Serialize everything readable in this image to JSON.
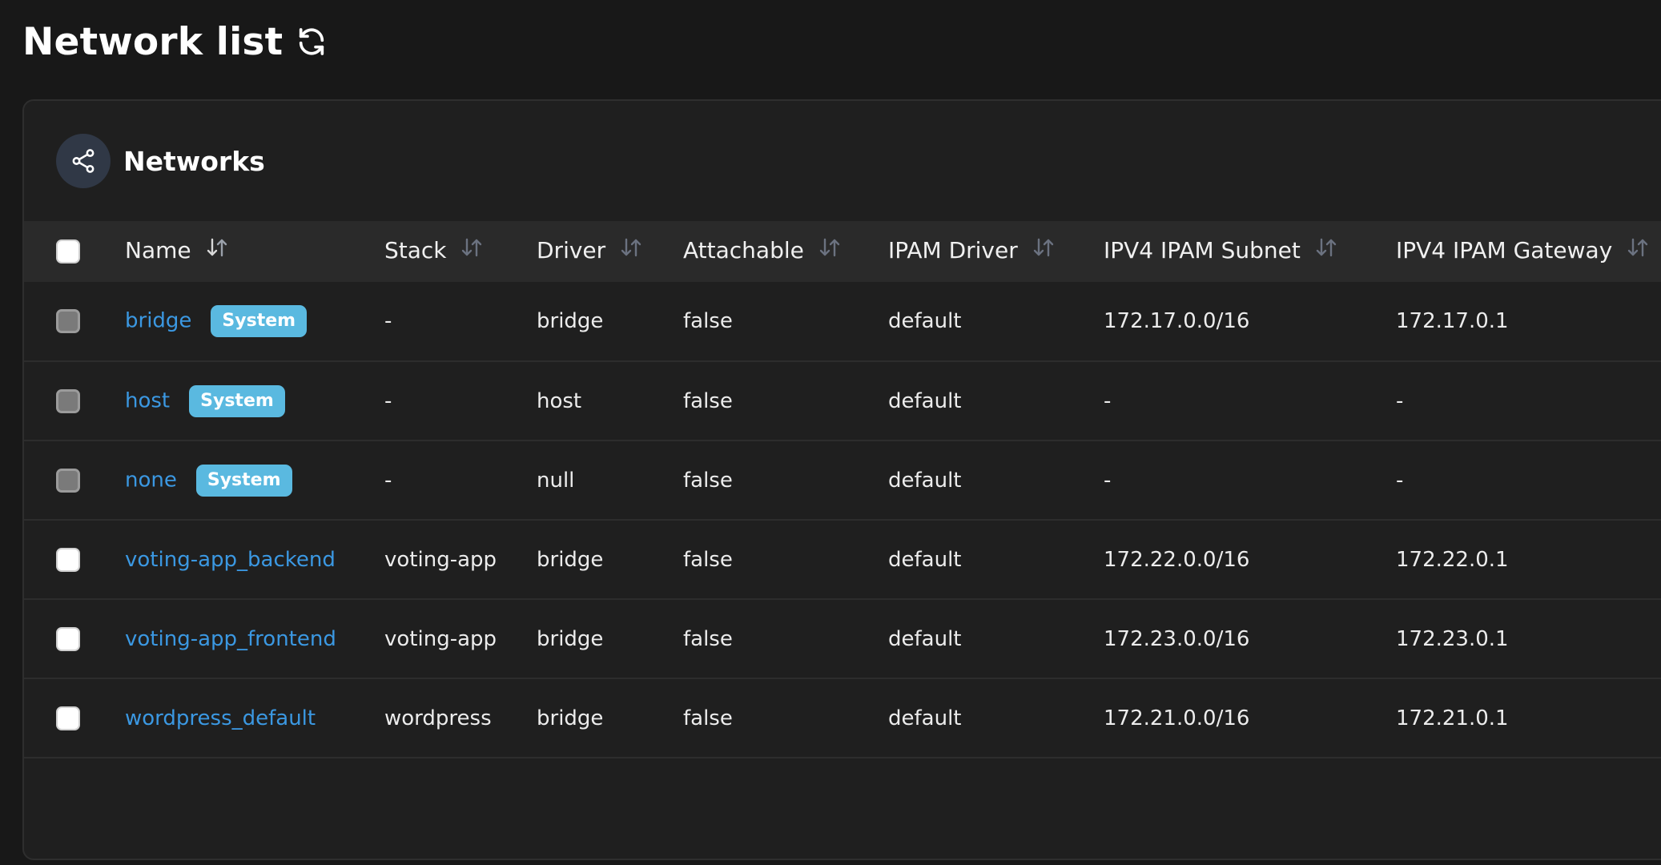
{
  "page": {
    "title": "Network list"
  },
  "panel": {
    "title": "Networks"
  },
  "table": {
    "columns": [
      "Name",
      "Stack",
      "Driver",
      "Attachable",
      "IPAM Driver",
      "IPV4 IPAM Subnet",
      "IPV4 IPAM Gateway"
    ],
    "rows": [
      {
        "name": "bridge",
        "badge": "System",
        "stack": "-",
        "driver": "bridge",
        "attachable": "false",
        "ipam_driver": "default",
        "subnet": "172.17.0.0/16",
        "gateway": "172.17.0.1"
      },
      {
        "name": "host",
        "badge": "System",
        "stack": "-",
        "driver": "host",
        "attachable": "false",
        "ipam_driver": "default",
        "subnet": "-",
        "gateway": "-"
      },
      {
        "name": "none",
        "badge": "System",
        "stack": "-",
        "driver": "null",
        "attachable": "false",
        "ipam_driver": "default",
        "subnet": "-",
        "gateway": "-"
      },
      {
        "name": "voting-app_backend",
        "badge": "",
        "stack": "voting-app",
        "driver": "bridge",
        "attachable": "false",
        "ipam_driver": "default",
        "subnet": "172.22.0.0/16",
        "gateway": "172.22.0.1"
      },
      {
        "name": "voting-app_frontend",
        "badge": "",
        "stack": "voting-app",
        "driver": "bridge",
        "attachable": "false",
        "ipam_driver": "default",
        "subnet": "172.23.0.0/16",
        "gateway": "172.23.0.1"
      },
      {
        "name": "wordpress_default",
        "badge": "",
        "stack": "wordpress",
        "driver": "bridge",
        "attachable": "false",
        "ipam_driver": "default",
        "subnet": "172.21.0.0/16",
        "gateway": "172.21.0.1"
      }
    ]
  },
  "icons": {
    "title_action": "refresh-icon",
    "panel": "share-nodes-icon",
    "sort": "sort-arrows-icon"
  },
  "colors": {
    "background": "#181818",
    "panel": "#1f1f1f",
    "header_row": "#2a2a2a",
    "link": "#3b98e2",
    "badge": "#5ab9e0",
    "sort_active": "#d8d8d8",
    "sort_inactive": "#6b7280"
  }
}
